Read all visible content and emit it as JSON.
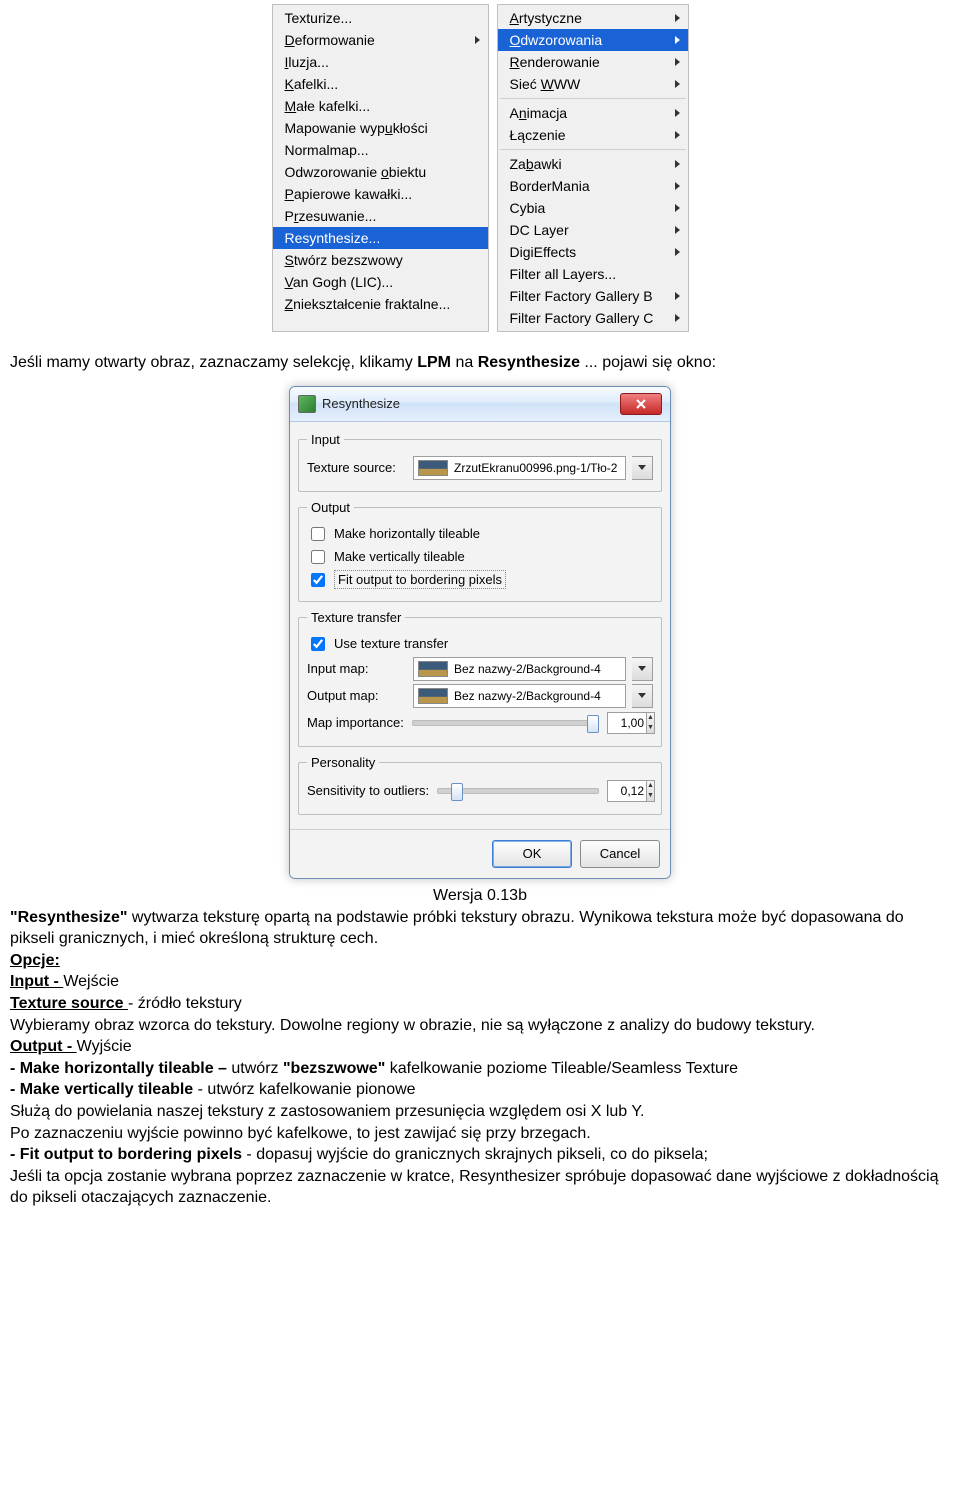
{
  "menu_left": {
    "items": [
      {
        "k": "texturize",
        "html": "Texturize..."
      },
      {
        "k": "deformowanie",
        "html": "<u>D</u>eformowanie",
        "arrow": true
      },
      {
        "k": "iluzja",
        "html": "<u>I</u>luzja..."
      },
      {
        "k": "kafelki",
        "html": "<u>K</u>afelki..."
      },
      {
        "k": "male-kafelki",
        "html": "<u>M</u>ałe kafelki..."
      },
      {
        "k": "mapowanie",
        "html": "Mapowanie wyp<u>u</u>kłości"
      },
      {
        "k": "normalmap",
        "html": "Normalmap..."
      },
      {
        "k": "odwzorowanie-obiektu",
        "html": "Odwzorowanie <u>o</u>biektu"
      },
      {
        "k": "papierowe",
        "html": "<u>P</u>apierowe kawałki..."
      },
      {
        "k": "przesuwanie",
        "html": "P<u>r</u>zesuwanie..."
      },
      {
        "k": "resynthesize",
        "html": "Resynthesize...",
        "hl": true
      },
      {
        "k": "bezszwowy",
        "html": "<u>S</u>twórz bezszwowy"
      },
      {
        "k": "van-gogh",
        "html": "<u>V</u>an Gogh (LIC)..."
      },
      {
        "k": "znieksztalcenie",
        "html": "<u>Z</u>niekształcenie fraktalne..."
      }
    ]
  },
  "menu_right": {
    "groups": [
      [
        {
          "k": "artystyczne",
          "html": "<u>A</u>rtystyczne",
          "arrow": true
        },
        {
          "k": "odwzorowania",
          "html": "<u>O</u>dwzorowania",
          "hl": true,
          "arrow": true
        },
        {
          "k": "renderowanie",
          "html": "<u>R</u>enderowanie",
          "arrow": true
        },
        {
          "k": "siec-www",
          "html": "Sieć <u>W</u>WW",
          "arrow": true
        }
      ],
      [
        {
          "k": "animacja",
          "html": "A<u>n</u>imacja",
          "arrow": true
        },
        {
          "k": "laczenie",
          "html": "Łączenie",
          "arrow": true
        }
      ],
      [
        {
          "k": "zabawki",
          "html": "Za<u>b</u>awki",
          "arrow": true
        },
        {
          "k": "bordermania",
          "html": "BorderMania",
          "arrow": true
        },
        {
          "k": "cybia",
          "html": "Cybia",
          "arrow": true
        },
        {
          "k": "dc-layer",
          "html": "DC Layer",
          "arrow": true
        },
        {
          "k": "digieffects",
          "html": "DigiEffects",
          "arrow": true
        },
        {
          "k": "filter-all",
          "html": "Filter all Layers..."
        },
        {
          "k": "ffgb",
          "html": "Filter Factory Gallery B",
          "arrow": true
        },
        {
          "k": "ffgc",
          "html": "Filter Factory Gallery C",
          "arrow": true
        }
      ]
    ]
  },
  "text1": {
    "pre": "Jeśli mamy otwarty obraz, zaznaczamy selekcję, klikamy ",
    "bold1": "LPM",
    "mid": " na  ",
    "bold2": "Resynthesize",
    "post": " ... pojawi się okno:"
  },
  "dialog": {
    "title": "Resynthesize",
    "input_legend": "Input",
    "texture_source_lbl": "Texture source:",
    "texture_source_val": "ZrzutEkranu00996.png-1/Tło-2",
    "output_legend": "Output",
    "chk_htile": "Make horizontally tileable",
    "chk_vtile": "Make vertically tileable",
    "chk_fit": "Fit output to bordering pixels",
    "transfer_legend": "Texture transfer",
    "chk_use_transfer": "Use texture transfer",
    "input_map_lbl": "Input map:",
    "input_map_val": "Bez nazwy-2/Background-4",
    "output_map_lbl": "Output map:",
    "output_map_val": "Bez nazwy-2/Background-4",
    "map_importance_lbl": "Map importance:",
    "map_importance_val": "1,00",
    "personality_legend": "Personality",
    "sensitivity_lbl": "Sensitivity to outliers:",
    "sensitivity_val": "0,12",
    "ok": "OK",
    "cancel": "Cancel"
  },
  "version": "Wersja 0.13b",
  "desc": {
    "p1a": "\"Resynthesize\"",
    "p1b": " wytwarza teksturę opartą na podstawie próbki tekstury obrazu. Wynikowa tekstura może być dopasowana do pikseli granicznych, i mieć określoną strukturę cech.",
    "opcje": "Opcje:",
    "input_b": "Input - ",
    "input_t": "Wejście",
    "texsrc_b": "Texture source  ",
    "texsrc_t": "- źródło tekstury",
    "wyb": "Wybieramy obraz wzorca do tekstury. Dowolne regiony w obrazie, nie są wyłączone z analizy do budowy tekstury.",
    "output_b": "Output - ",
    "output_t": "Wyjście",
    "htile_b": " - Make horizontally tileable – ",
    "htile_t": "utwórz ",
    "htile_q": "\"bezszwowe\"",
    "htile_t2": " kafelkowanie poziome  Tileable/Seamless Texture",
    "vtile_b": " - Make vertically tileable",
    "vtile_t": " - utwórz kafelkowanie pionowe",
    "sluza": "Służą do powielania naszej tekstury z zastosowaniem przesunięcia względem osi X lub Y.",
    "pozaz": "Po zaznaczeniu wyjście powinno być kafelkowe, to jest zawijać się przy brzegach.",
    "fit_b": " - Fit output to bordering pixels",
    "fit_t": " - dopasuj wyjście do granicznych skrajnych pikseli, co do piksela;",
    "jesli": "Jeśli ta opcja zostanie wybrana poprzez zaznaczenie w kratce, Resynthesizer spróbuje dopasować dane wyjściowe z dokładnością do pikseli otaczających zaznaczenie."
  }
}
